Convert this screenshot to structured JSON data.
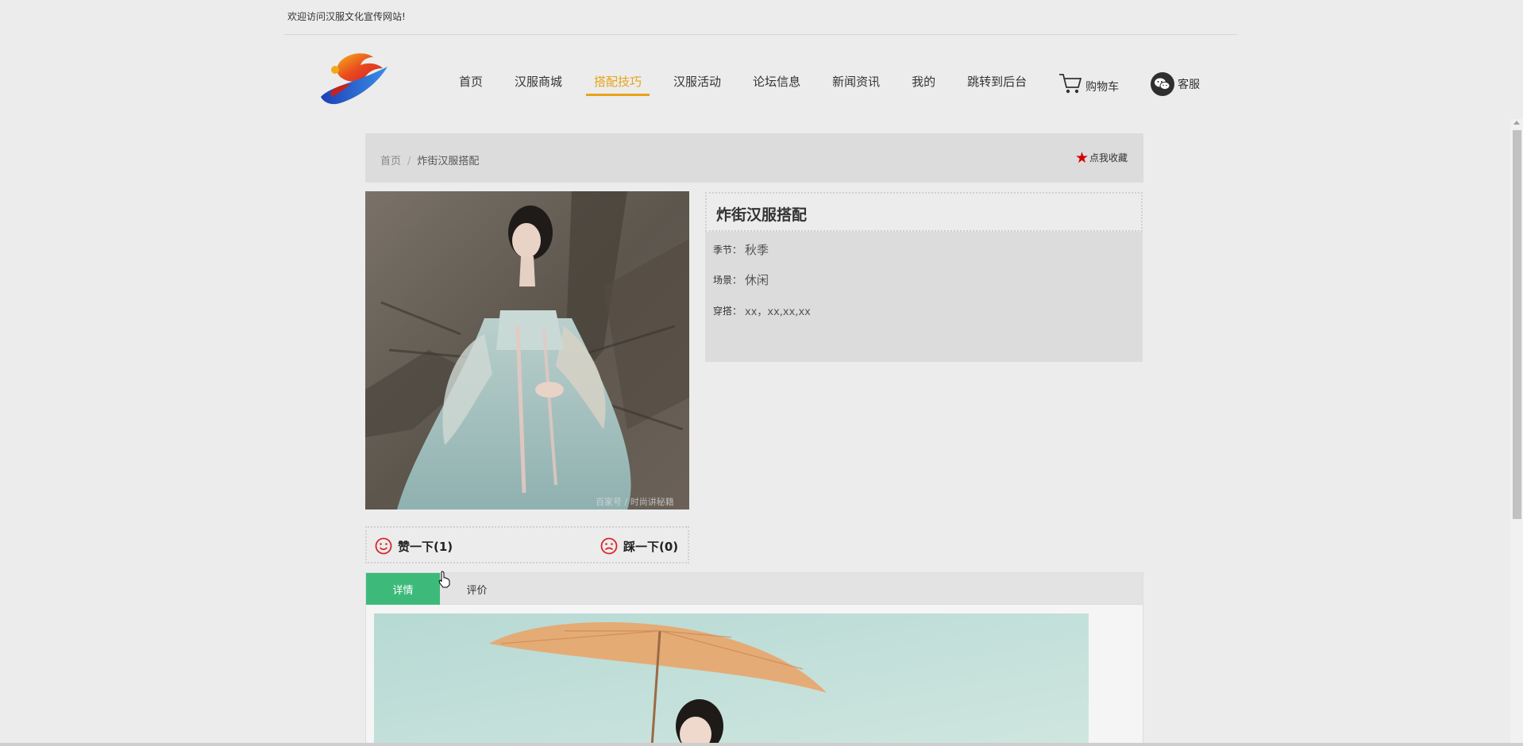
{
  "topbar": {
    "welcome": "欢迎访问汉服文化宣传网站!"
  },
  "logo": {
    "icon": "brand-logo-icon"
  },
  "nav": {
    "items": [
      "首页",
      "汉服商城",
      "搭配技巧",
      "汉服活动",
      "论坛信息",
      "新闻资讯",
      "我的",
      "跳转到后台"
    ],
    "active_index": 2,
    "cart_label": "购物车",
    "service_label": "客服",
    "active_color": "#e8a317"
  },
  "breadcrumb": {
    "home": "首页",
    "separator": "/",
    "current": "炸街汉服搭配"
  },
  "favorite": {
    "label": "点我收藏",
    "icon": "star-icon",
    "color": "#d40000"
  },
  "detail": {
    "title": "炸街汉服搭配",
    "fields": [
      {
        "key": "季节：",
        "value": "秋季"
      },
      {
        "key": "场景：",
        "value": "休闲"
      },
      {
        "key": "穿搭：",
        "value": "xx，xx,xx,xx"
      }
    ]
  },
  "votes": {
    "like": {
      "label": "赞一下(1)",
      "icon": "smile-icon"
    },
    "dislike": {
      "label": "踩一下(0)",
      "icon": "frown-icon"
    }
  },
  "tabs": {
    "items": [
      "详情",
      "评价"
    ],
    "active_index": 0,
    "active_color": "#3dba7a"
  }
}
